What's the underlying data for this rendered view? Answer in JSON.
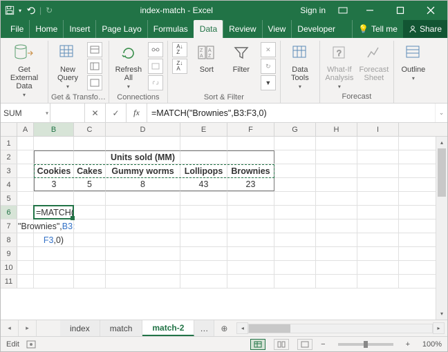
{
  "title": "index-match - Excel",
  "signin": "Sign in",
  "ribbon_tabs": {
    "file": "File",
    "home": "Home",
    "insert": "Insert",
    "page": "Page Layo",
    "formulas": "Formulas",
    "data": "Data",
    "review": "Review",
    "view": "View",
    "developer": "Developer",
    "tellme": "Tell me",
    "share": "Share"
  },
  "ribbon": {
    "get_external": "Get External\nData",
    "new_query": "New\nQuery",
    "group_transform": "Get & Transfo…",
    "refresh": "Refresh\nAll",
    "group_connections": "Connections",
    "sort": "Sort",
    "filter": "Filter",
    "group_sortfilter": "Sort & Filter",
    "data_tools": "Data\nTools",
    "whatif": "What-If\nAnalysis",
    "forecast_sheet": "Forecast\nSheet",
    "group_forecast": "Forecast",
    "outline": "Outline"
  },
  "formula_bar": {
    "name": "SUM",
    "formula": "=MATCH(\"Brownies\",B3:F3,0)"
  },
  "grid": {
    "cols": [
      "A",
      "B",
      "C",
      "D",
      "E",
      "F",
      "G",
      "H",
      "I"
    ],
    "r2": {
      "title": "Units sold (MM)"
    },
    "r3": {
      "b": "Cookies",
      "c": "Cakes",
      "d": "Gummy worms",
      "e": "Lollipops",
      "f": "Brownies"
    },
    "r4": {
      "b": "3",
      "c": "5",
      "d": "8",
      "e": "43",
      "f": "23"
    },
    "r6": "=MATCH(",
    "r7a": "\"Brownies\",",
    "r7b": "B3:",
    "r8a": "F3",
    "r8b": ",0)"
  },
  "sheets": {
    "s1": "index",
    "s2": "match",
    "s3": "match-2",
    "more": "…"
  },
  "status": {
    "mode": "Edit",
    "zoom": "100%"
  }
}
